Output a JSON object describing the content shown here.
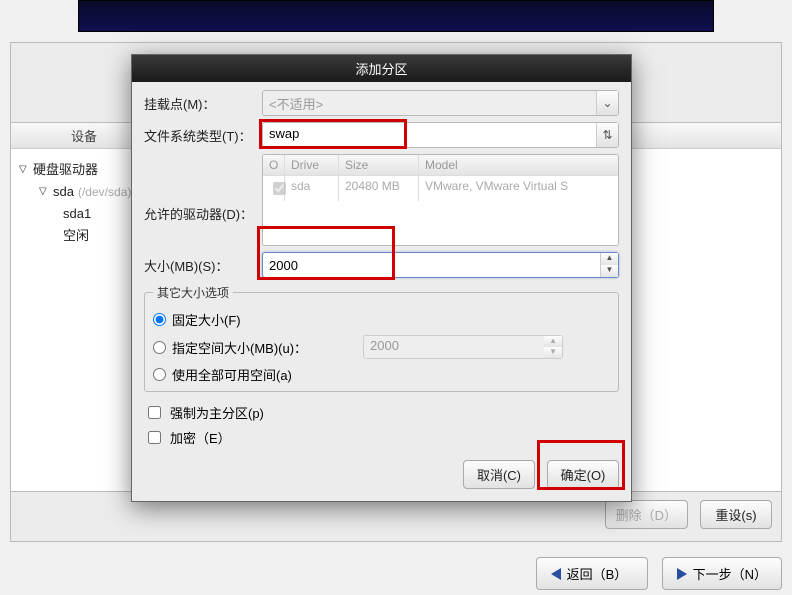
{
  "banner": {},
  "device_panel": {
    "header": "设备",
    "root": "硬盘驱动器",
    "disk": "sda",
    "disk_path": "(/dev/sda)",
    "part1": "sda1",
    "free": "空闲"
  },
  "dialog": {
    "title": "添加分区",
    "mount_label": "挂载点(M)：",
    "mount_value": "<不适用>",
    "fstype_label": "文件系统类型(T)：",
    "fstype_value": "swap",
    "drives_label": "允许的驱动器(D)：",
    "drive_headers": {
      "chk": "O",
      "drive": "Drive",
      "size": "Size",
      "model": "Model"
    },
    "drive_row": {
      "drive": "sda",
      "size": "20480 MB",
      "model": "VMware, VMware Virtual S"
    },
    "size_label": "大小(MB)(S)：",
    "size_value": "2000",
    "group_label": "其它大小选项",
    "opt_fixed": "固定大小(F)",
    "opt_upto": "指定空间大小(MB)(u)：",
    "opt_upto_value": "2000",
    "opt_all": "使用全部可用空间(a)",
    "chk_primary": "强制为主分区(p)",
    "chk_encrypt": "加密（E）",
    "btn_cancel": "取消(C)",
    "btn_ok": "确定(O)"
  },
  "main_buttons": {
    "delete": "删除（D）",
    "reset": "重设(s)",
    "back": "返回（B）",
    "next": "下一步（N）"
  }
}
